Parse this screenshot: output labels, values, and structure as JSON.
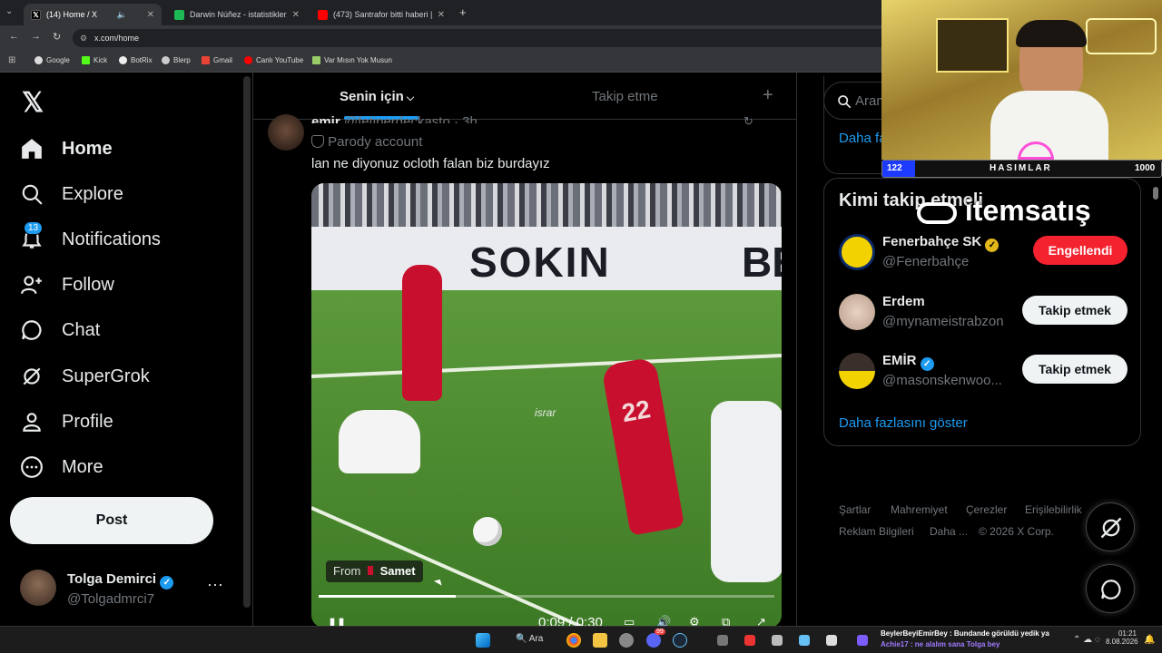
{
  "browser": {
    "tabs": [
      {
        "title": "(14) Home / X",
        "active": true
      },
      {
        "title": "Darwin Núñez - istatistikler, kar",
        "active": false
      },
      {
        "title": "(473) Santrafor bitti haberi | Sü",
        "active": false
      }
    ],
    "url": "x.com/home",
    "bookmarks": [
      "Google",
      "Kick",
      "BotRix",
      "Blerp",
      "Gmail",
      "Canlı YouTube",
      "Var Mısın Yok Musun"
    ]
  },
  "nav": {
    "items": [
      {
        "label": "Home",
        "icon": "home-icon"
      },
      {
        "label": "Explore",
        "icon": "search-icon"
      },
      {
        "label": "Notifications",
        "icon": "bell-icon",
        "badge": "13"
      },
      {
        "label": "Follow",
        "icon": "person-add-icon"
      },
      {
        "label": "Chat",
        "icon": "chat-icon"
      },
      {
        "label": "SuperGrok",
        "icon": "grok-icon"
      },
      {
        "label": "Profile",
        "icon": "person-icon"
      },
      {
        "label": "More",
        "icon": "more-circle-icon"
      }
    ],
    "post_label": "Post",
    "account": {
      "name": "Tolga Demirci",
      "handle": "@Tolgadmrci7"
    }
  },
  "feed": {
    "tabs": {
      "for_you": "Senin için",
      "following": "Takip etme"
    },
    "post": {
      "author": "emir",
      "handle": "@fetiperdeckasto · 3h",
      "parody_label": "Parody account",
      "text": "lan ne diyonuz ocloth falan biz burdayız",
      "video": {
        "from_label": "From",
        "from_name": "Samet",
        "time": "0:09 / 0:30",
        "progress": 0.3,
        "ad_board": "SOKIN",
        "ad_board_right": "BE",
        "player_number": "22",
        "overlay_word": "israr"
      }
    }
  },
  "sidebar": {
    "search_placeholder": "Aram",
    "trends_more": "Daha fa",
    "who_to_follow": {
      "title": "Kimi takip etmeli",
      "users": [
        {
          "name": "Fenerbahçe SK",
          "handle": "@Fenerbahçe",
          "button": "Engellendi",
          "verified": "gold"
        },
        {
          "name": "Erdem",
          "handle": "@mynameistrabzon",
          "button": "Takip etmek",
          "verified": ""
        },
        {
          "name": "EMİR",
          "handle": "@masonskenwoo...",
          "button": "Takip etmek",
          "verified": "blue"
        }
      ],
      "show_more": "Daha fazlasını göster"
    },
    "footer": [
      "Şartlar",
      "Mahremiyet",
      "Çerezler",
      "Erişilebilirlik",
      "Reklam Bilgileri",
      "Daha ...",
      "© 2026 X Corp."
    ]
  },
  "overlay": {
    "sponsor": "itemsatış",
    "score_label": "HASIMLAR",
    "score_left": "122",
    "score_right": "1000"
  },
  "taskbar": {
    "search": "Ara",
    "chat_line1": "BeylerBeyiEmirBey : Bundande görüldü yedik ya",
    "chat_line2": "Achie17 : ne alalım sana Tolga bey",
    "time": "01:21",
    "date": "8.08.2026",
    "discord_badge": "99"
  },
  "colors": {
    "accent": "#1d9bf0",
    "danger": "#f4212e",
    "gold": "#e2b719"
  }
}
